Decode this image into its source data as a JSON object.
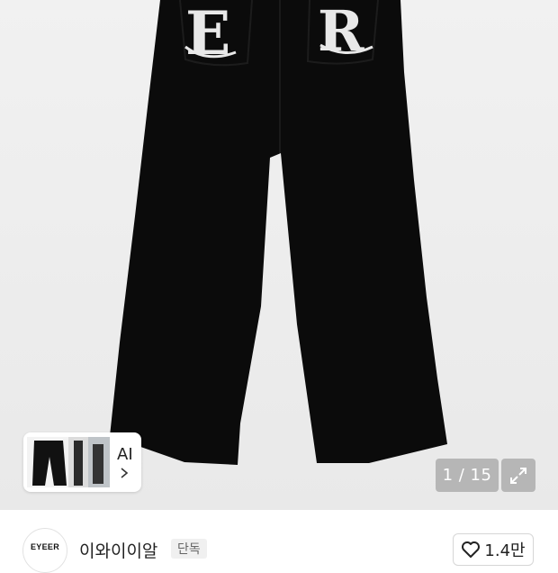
{
  "gallery": {
    "counter": "1 / 15",
    "ai_label": "AI"
  },
  "store": {
    "logo_text": "EYEER",
    "name": "이와이이알",
    "tag": "단독",
    "likes": "1.4만"
  },
  "icons": {
    "expand": "expand-icon",
    "heart": "heart-icon",
    "chevron": "chevron-right-icon"
  },
  "colors": {
    "product": "#0b0b0b",
    "print": "#e8e8e8"
  }
}
